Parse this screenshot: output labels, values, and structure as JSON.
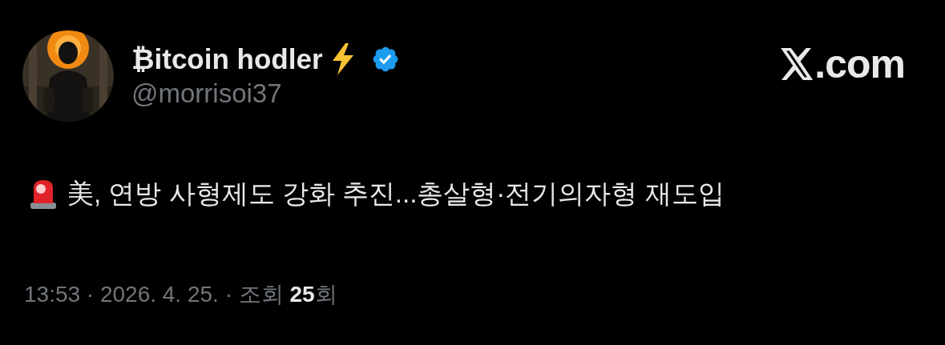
{
  "author": {
    "name": "₿itcoin hodler",
    "verified": true,
    "handle": "@morrisoi37"
  },
  "site": {
    "domain": ".com"
  },
  "post": {
    "text": "美, 연방 사형제도 강화 추진...총살형·전기의자형 재도입"
  },
  "meta": "13:53 · 2026. 4. 25. · 조회 **25**회"
}
